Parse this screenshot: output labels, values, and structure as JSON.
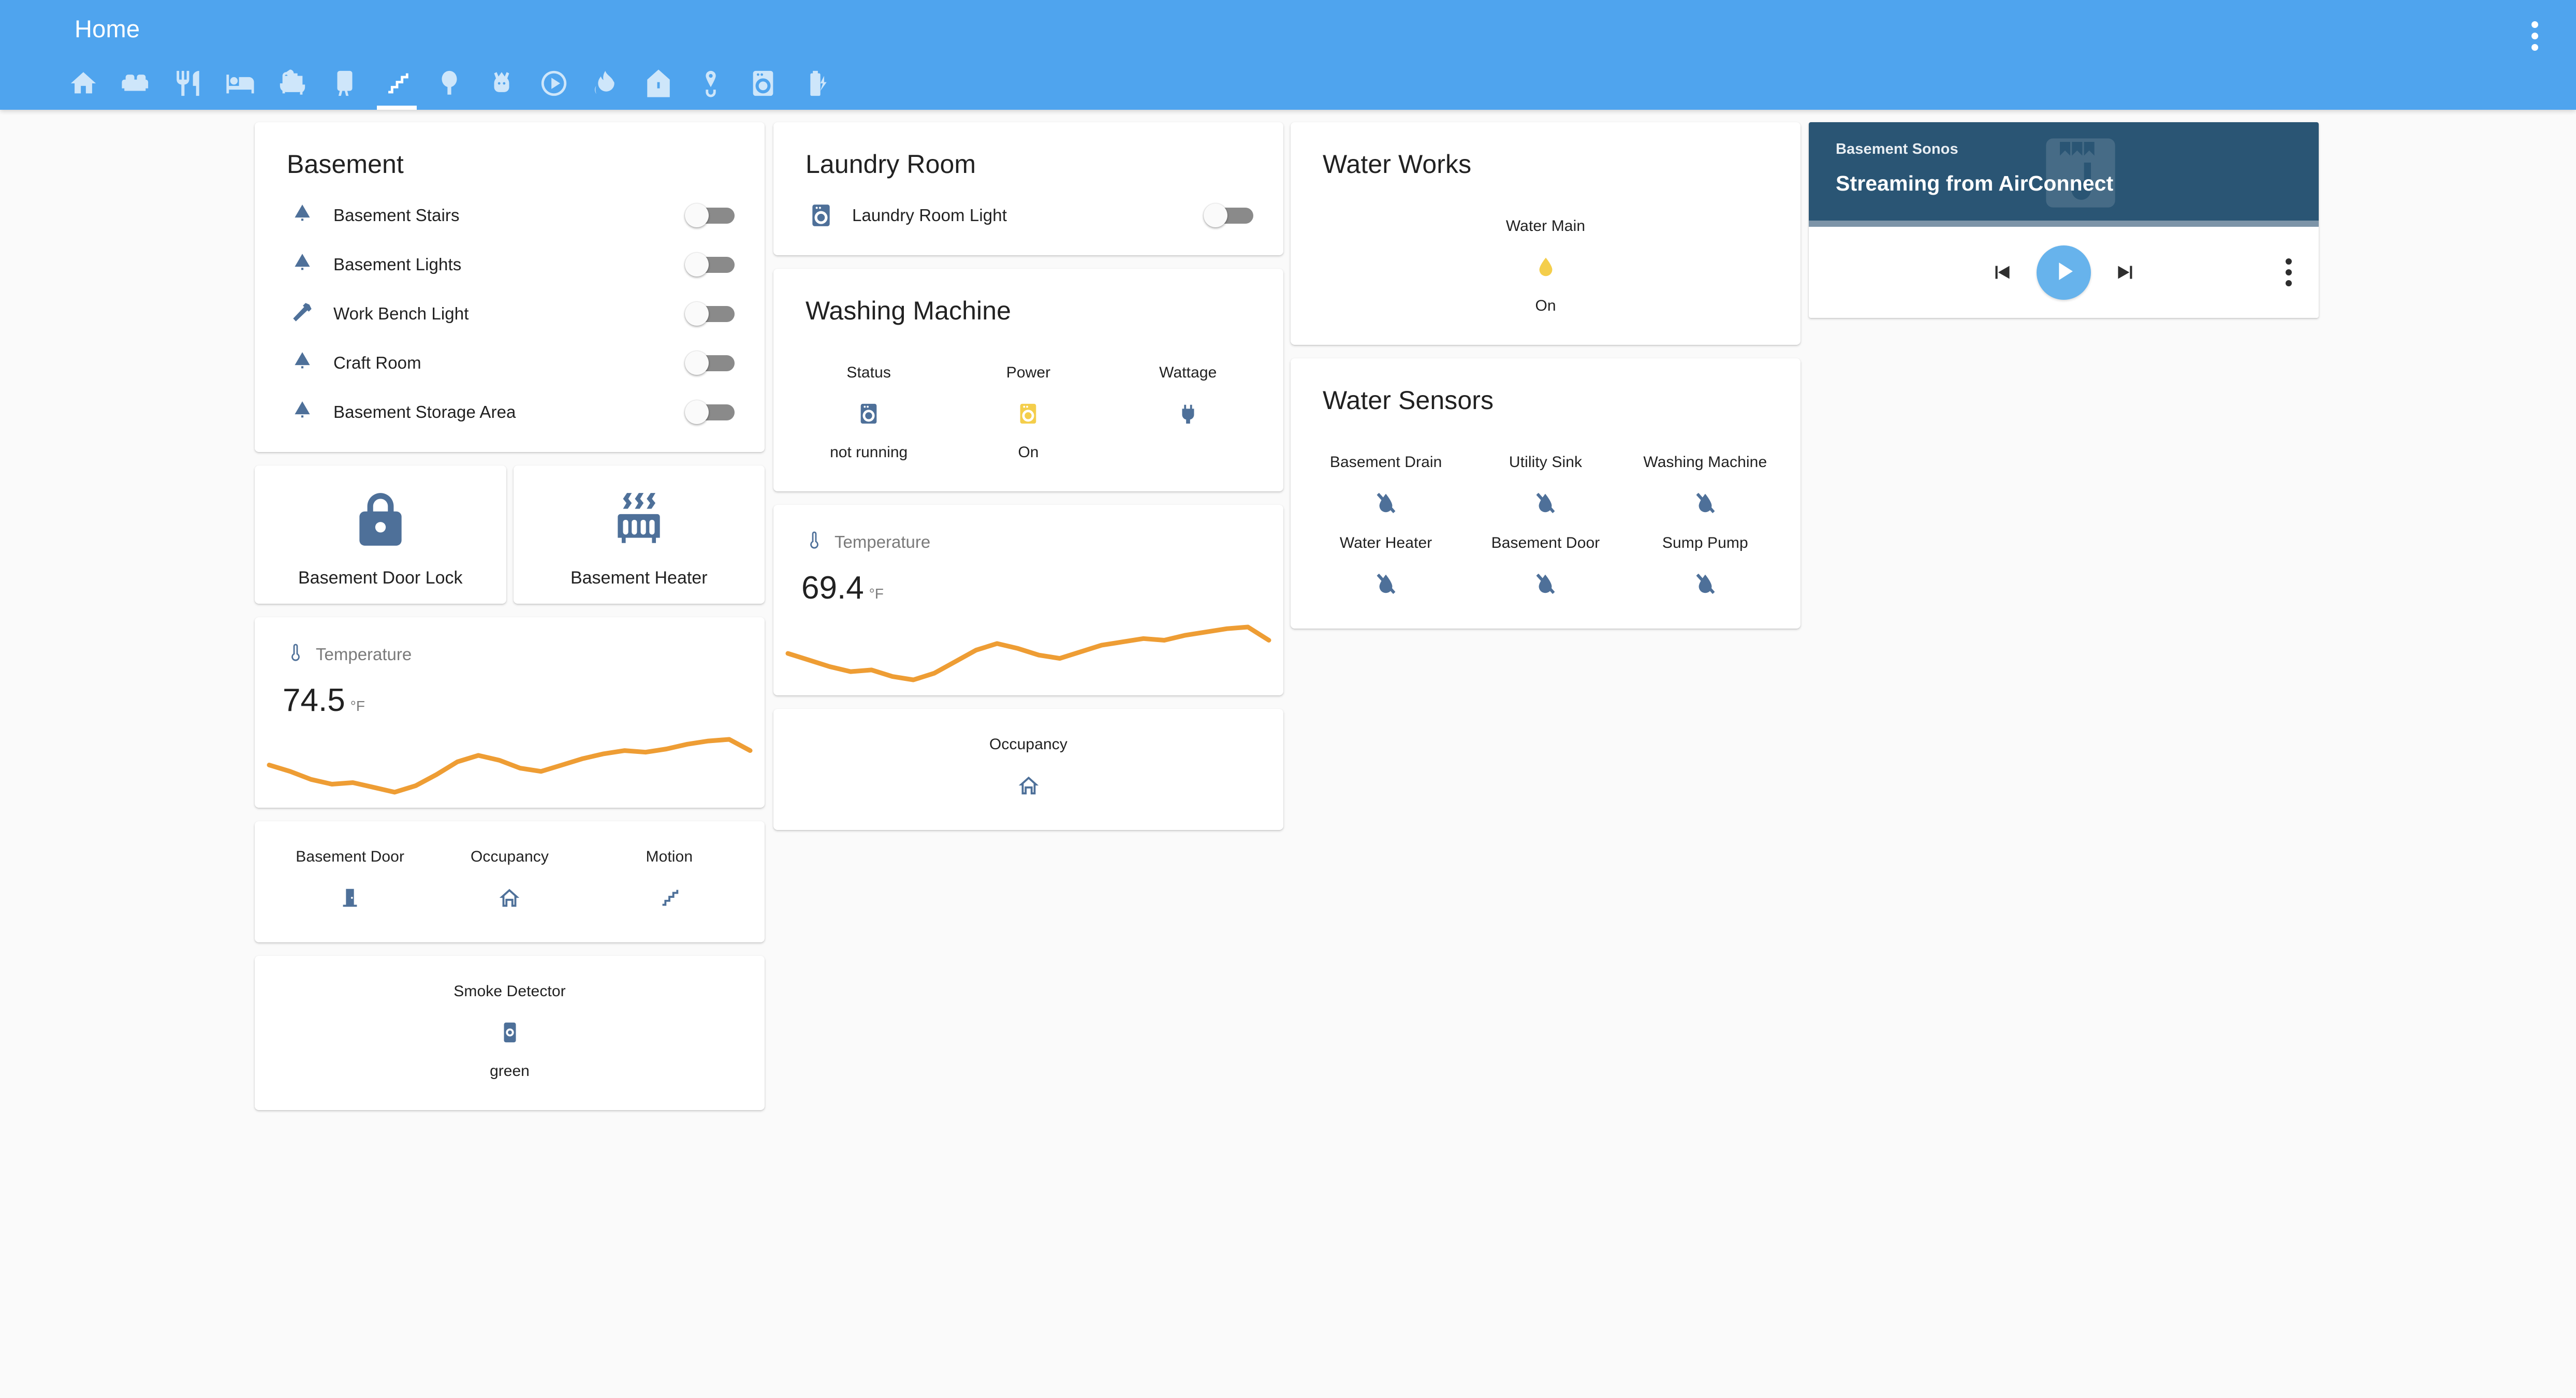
{
  "appbar": {
    "title": "Home",
    "overflow_icon": "dots-vertical-icon",
    "background": "#4fa4ee"
  },
  "tabs": [
    {
      "icon": "home-icon",
      "name": "tab-home",
      "active": false
    },
    {
      "icon": "sofa-icon",
      "name": "tab-living-room",
      "active": false
    },
    {
      "icon": "silverware-fork-knife-icon",
      "name": "tab-dining-room",
      "active": false
    },
    {
      "icon": "bed-icon",
      "name": "tab-bedroom",
      "active": false
    },
    {
      "icon": "bathtub-icon",
      "name": "tab-bathroom",
      "active": false
    },
    {
      "icon": "television-icon",
      "name": "tab-media-room",
      "active": false
    },
    {
      "icon": "stairs-icon",
      "name": "tab-basement",
      "active": true
    },
    {
      "icon": "tree-icon",
      "name": "tab-outdoors",
      "active": false
    },
    {
      "icon": "cat-icon",
      "name": "tab-pets",
      "active": false
    },
    {
      "icon": "play-circle-icon",
      "name": "tab-media",
      "active": false
    },
    {
      "icon": "fire-icon",
      "name": "tab-climate",
      "active": false
    },
    {
      "icon": "home-variant-icon",
      "name": "tab-house",
      "active": false
    },
    {
      "icon": "water-pump-icon",
      "name": "tab-water",
      "active": false
    },
    {
      "icon": "washing-machine-icon",
      "name": "tab-laundry",
      "active": false
    },
    {
      "icon": "flash-battery-icon",
      "name": "tab-energy",
      "active": false
    }
  ],
  "basement_card": {
    "title": "Basement",
    "entities": [
      {
        "label": "Basement Stairs",
        "icon": "ceiling-light-icon",
        "state": "off"
      },
      {
        "label": "Basement Lights",
        "icon": "ceiling-light-icon",
        "state": "off"
      },
      {
        "label": "Work Bench Light",
        "icon": "hammer-icon",
        "state": "off"
      },
      {
        "label": "Craft Room",
        "icon": "ceiling-light-icon",
        "state": "off"
      },
      {
        "label": "Basement Storage Area",
        "icon": "ceiling-light-icon",
        "state": "off"
      }
    ]
  },
  "basement_buttons": [
    {
      "label": "Basement Door Lock",
      "icon": "lock-icon"
    },
    {
      "label": "Basement Heater",
      "icon": "radiator-icon"
    }
  ],
  "basement_temperature": {
    "header_label": "Temperature",
    "header_icon": "thermometer-icon",
    "value": "74.5",
    "unit": "°F",
    "line_color": "#ee9d34"
  },
  "basement_sensors": [
    {
      "label": "Basement Door",
      "icon": "door-icon"
    },
    {
      "label": "Occupancy",
      "icon": "home-outline-icon"
    },
    {
      "label": "Motion",
      "icon": "stairs-icon"
    }
  ],
  "smoke_detector": {
    "label": "Smoke Detector",
    "icon": "smoke-detector-icon",
    "state": "green"
  },
  "laundry_card": {
    "title": "Laundry Room",
    "entities": [
      {
        "label": "Laundry Room Light",
        "icon": "washing-machine-icon",
        "state": "off"
      }
    ]
  },
  "washing_machine_card": {
    "title": "Washing Machine",
    "items": [
      {
        "label": "Status",
        "icon": "washing-machine-icon",
        "state": "not running",
        "tint": "blue"
      },
      {
        "label": "Power",
        "icon": "washing-machine-icon",
        "state": "On",
        "tint": "amber"
      },
      {
        "label": "Wattage",
        "icon": "power-plug-icon",
        "state": "",
        "tint": "blue"
      }
    ]
  },
  "laundry_temperature": {
    "header_label": "Temperature",
    "header_icon": "thermometer-icon",
    "value": "69.4",
    "unit": "°F",
    "line_color": "#ee9d34"
  },
  "laundry_occupancy": {
    "label": "Occupancy",
    "icon": "home-outline-icon"
  },
  "water_works_card": {
    "title": "Water Works",
    "items": [
      {
        "label": "Water Main",
        "icon": "water-icon",
        "state": "On",
        "tint": "amber"
      }
    ]
  },
  "water_sensors_card": {
    "title": "Water Sensors",
    "items": [
      {
        "label": "Basement Drain",
        "icon": "water-off-icon"
      },
      {
        "label": "Utility Sink",
        "icon": "water-off-icon"
      },
      {
        "label": "Washing Machine",
        "icon": "water-off-icon"
      },
      {
        "label": "Water Heater",
        "icon": "water-off-icon"
      },
      {
        "label": "Basement Door",
        "icon": "water-off-icon"
      },
      {
        "label": "Sump Pump",
        "icon": "water-off-icon"
      }
    ]
  },
  "media_player": {
    "device": "Basement Sonos",
    "now_playing": "Streaming from AirConnect",
    "watermark_icon": "album-music-icon",
    "header_color": "#2a5574",
    "play_button_color": "#67b3ec",
    "controls": {
      "previous": "skip-previous-icon",
      "play": "play-icon",
      "next": "skip-next-icon",
      "more": "dots-vertical-icon"
    }
  },
  "chart_data": [
    {
      "type": "line",
      "title": "Temperature",
      "ylabel": "°F",
      "current_value": 74.5,
      "line_color": "#ee9d34",
      "grid": false,
      "legend": "none",
      "x": [
        0,
        1,
        2,
        3,
        4,
        5,
        6,
        7,
        8,
        9,
        10,
        11,
        12,
        13,
        14,
        15,
        16,
        17,
        18,
        19,
        20,
        21,
        22,
        23
      ],
      "values": [
        73.6,
        73.2,
        72.7,
        72.4,
        72.5,
        72.2,
        71.9,
        72.3,
        73.0,
        73.8,
        74.2,
        73.9,
        73.4,
        73.2,
        73.6,
        74.0,
        74.3,
        74.5,
        74.4,
        74.6,
        74.9,
        75.1,
        75.2,
        74.5
      ]
    },
    {
      "type": "line",
      "title": "Temperature",
      "ylabel": "°F",
      "current_value": 69.4,
      "line_color": "#ee9d34",
      "grid": false,
      "legend": "none",
      "x": [
        0,
        1,
        2,
        3,
        4,
        5,
        6,
        7,
        8,
        9,
        10,
        11,
        12,
        13,
        14,
        15,
        16,
        17,
        18,
        19,
        20,
        21,
        22,
        23
      ],
      "values": [
        68.6,
        68.2,
        67.8,
        67.5,
        67.6,
        67.2,
        67.0,
        67.4,
        68.1,
        68.8,
        69.2,
        68.9,
        68.5,
        68.3,
        68.7,
        69.1,
        69.3,
        69.5,
        69.4,
        69.7,
        69.9,
        70.1,
        70.2,
        69.4
      ]
    }
  ]
}
